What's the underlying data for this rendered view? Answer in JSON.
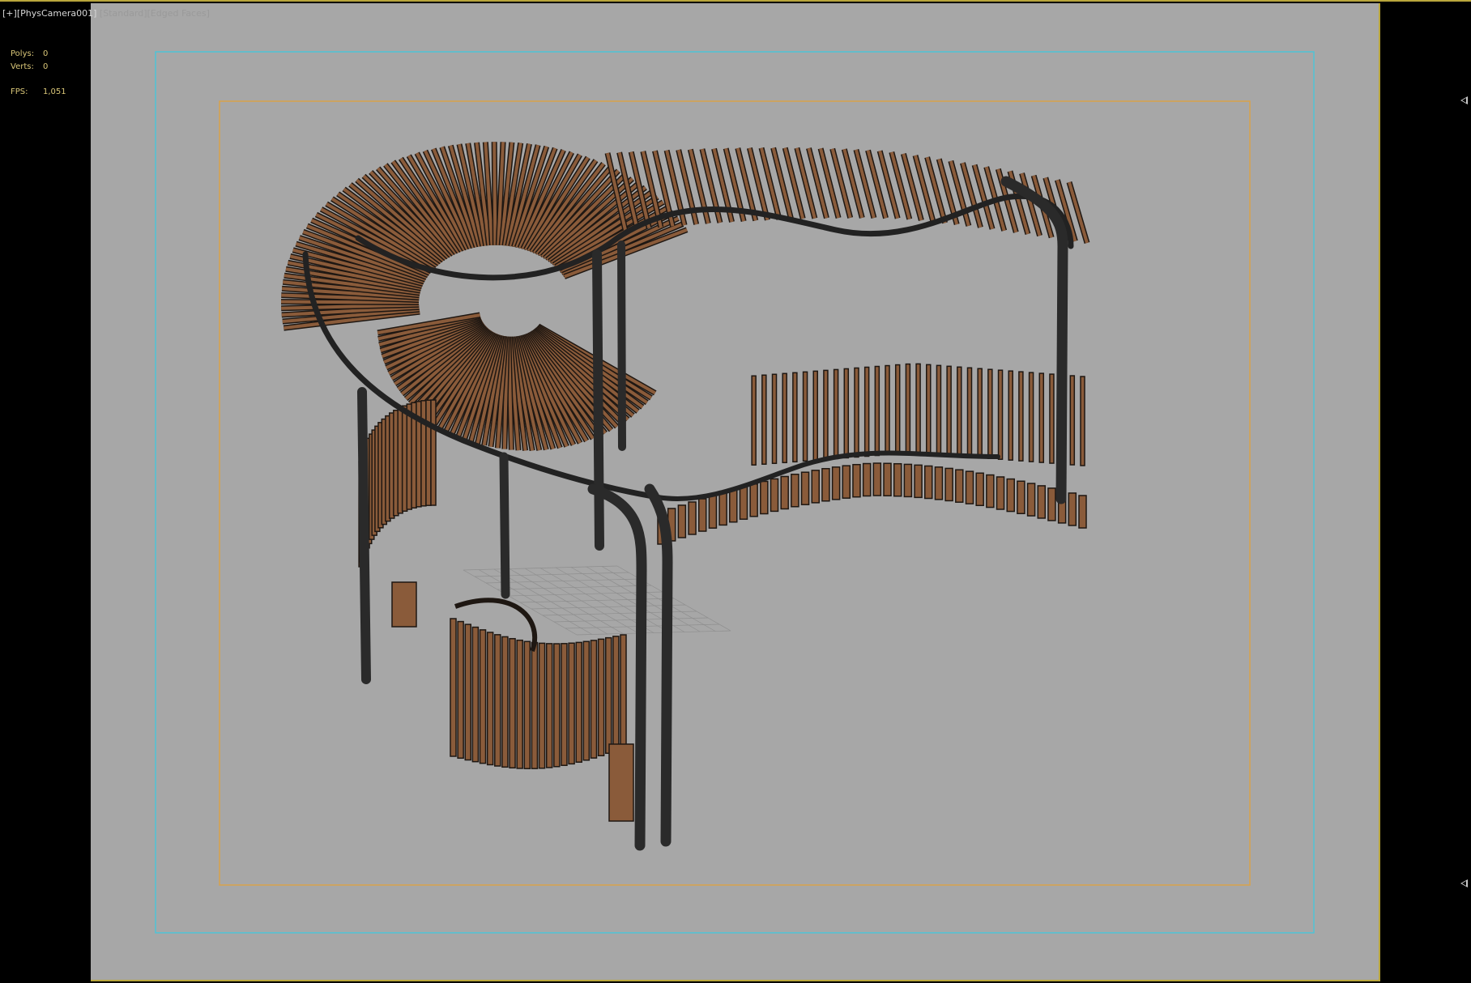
{
  "viewport": {
    "plus_menu": "[+]",
    "camera_label": "[PhysCamera001]",
    "shading_label": "[Standard]",
    "display_label": "[Edged Faces]"
  },
  "stats": {
    "polys_label": "Polys:",
    "polys_value": "0",
    "verts_label": "Verts:",
    "verts_value": "0",
    "fps_label": "FPS:",
    "fps_value": "1,051"
  },
  "colors": {
    "viewport_bg": "#a7a7a7",
    "safe_frame_outer": "#4fc3d6",
    "safe_frame_inner": "#d9a24a",
    "active_border": "#b9a63c",
    "wood": "#8a5b3a",
    "steel": "#2a2a2a"
  },
  "scene": {
    "object": "curved-pergola-with-benches",
    "axis_gizmo": "axis-tripod-icon"
  }
}
